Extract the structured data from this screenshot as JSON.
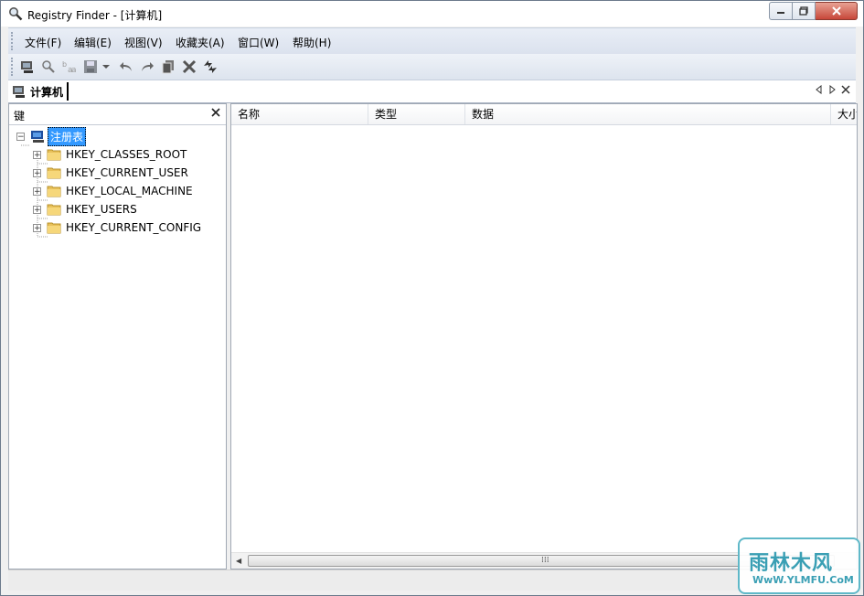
{
  "window": {
    "title": "Registry Finder - [计算机]"
  },
  "menubar": {
    "items": [
      "文件(F)",
      "编辑(E)",
      "视图(V)",
      "收藏夹(A)",
      "窗口(W)",
      "帮助(H)"
    ]
  },
  "toolbar": {
    "buttons": [
      "computer-icon",
      "search-icon",
      "replace-icon",
      "save-icon",
      "dropdown-icon",
      "undo-icon",
      "redo-icon",
      "copy-icon",
      "delete-icon",
      "refresh-icon"
    ]
  },
  "tab": {
    "label": "计算机"
  },
  "left_pane": {
    "title": "键",
    "root": "注册表",
    "items": [
      "HKEY_CLASSES_ROOT",
      "HKEY_CURRENT_USER",
      "HKEY_LOCAL_MACHINE",
      "HKEY_USERS",
      "HKEY_CURRENT_CONFIG"
    ]
  },
  "right_pane": {
    "columns": [
      "名称",
      "类型",
      "数据",
      "大小"
    ]
  },
  "watermark": {
    "main": "雨林木风",
    "sub": "WwW.YLMFU.CoM"
  },
  "colors": {
    "selection": "#3399ff",
    "close_button": "#c7473a"
  }
}
